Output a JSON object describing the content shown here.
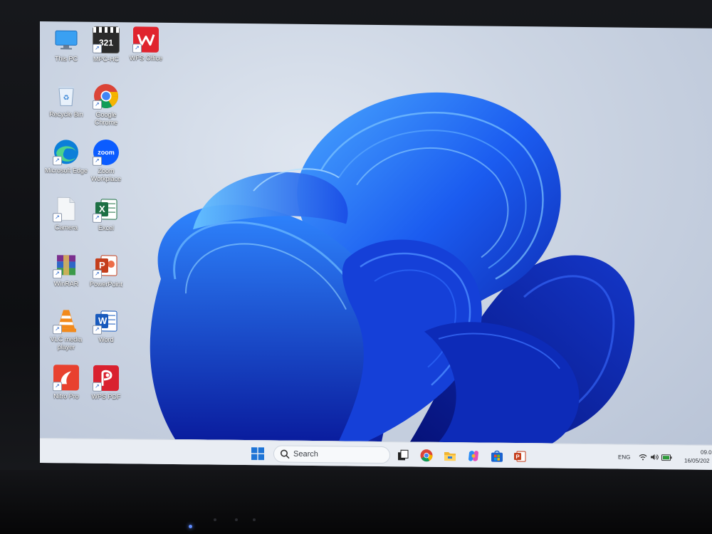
{
  "desktop": {
    "icons": [
      {
        "label": "This PC",
        "icon": "monitor-icon"
      },
      {
        "label": "MPC-HC",
        "icon": "mpc-hc-icon"
      },
      {
        "label": "WPS Office",
        "icon": "wps-office-icon"
      },
      {
        "label": "Recycle Bin",
        "icon": "recycle-bin-icon"
      },
      {
        "label": "Google Chrome",
        "icon": "chrome-icon"
      },
      {
        "label": "Microsoft Edge",
        "icon": "edge-icon"
      },
      {
        "label": "Zoom Workplace",
        "icon": "zoom-icon"
      },
      {
        "label": "Camera",
        "icon": "file-icon"
      },
      {
        "label": "Excel",
        "icon": "excel-icon"
      },
      {
        "label": "WinRAR",
        "icon": "winrar-icon"
      },
      {
        "label": "PowerPoint",
        "icon": "powerpoint-icon"
      },
      {
        "label": "VLC media player",
        "icon": "vlc-icon"
      },
      {
        "label": "Word",
        "icon": "word-icon"
      },
      {
        "label": "Nitro Pro",
        "icon": "nitro-icon"
      },
      {
        "label": "WPS PDF",
        "icon": "wps-pdf-icon"
      }
    ],
    "icon_glyph_text": {
      "mpc": "321",
      "zoom": "zoom",
      "excel": "X",
      "powerpoint": "P",
      "word": "W"
    }
  },
  "taskbar": {
    "search_placeholder": "Search",
    "apps": [
      "start-icon",
      "task-view-icon",
      "chrome-icon",
      "file-explorer-icon",
      "copilot-icon",
      "store-icon",
      "powerpoint-icon"
    ],
    "tray": {
      "language": "ENG",
      "time": "09.0",
      "date": "16/05/202"
    }
  },
  "colors": {
    "accent_blue": "#1d4fe0",
    "taskbar_bg": "#e9edf3"
  }
}
